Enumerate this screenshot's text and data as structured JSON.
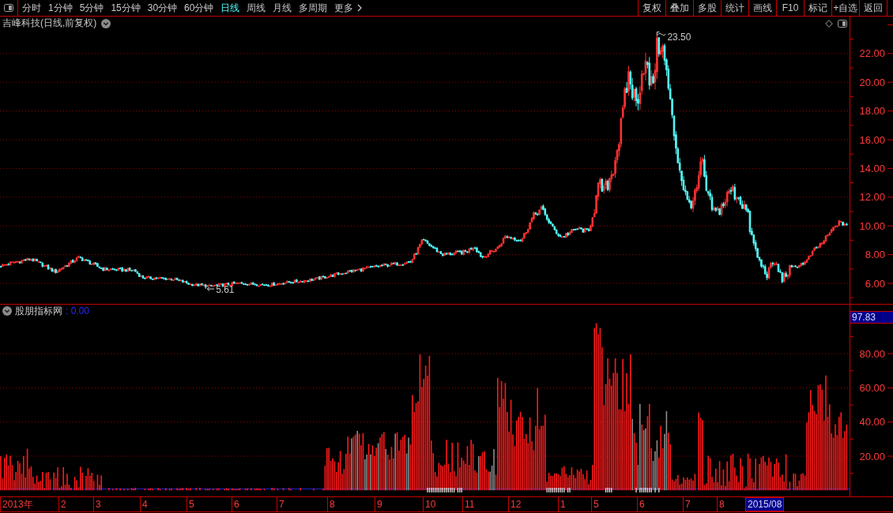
{
  "toolbar": {
    "tabs": [
      {
        "label": "分时",
        "kind": "period",
        "selected": false
      },
      {
        "label": "1分钟",
        "kind": "period",
        "selected": false
      },
      {
        "label": "5分钟",
        "kind": "period",
        "selected": false
      },
      {
        "label": "15分钟",
        "kind": "period",
        "selected": false
      },
      {
        "label": "30分钟",
        "kind": "period",
        "selected": false
      },
      {
        "label": "60分钟",
        "kind": "period",
        "selected": false
      },
      {
        "label": "日线",
        "kind": "period",
        "selected": true
      },
      {
        "label": "周线",
        "kind": "period",
        "selected": false
      },
      {
        "label": "月线",
        "kind": "period",
        "selected": false
      },
      {
        "label": "多周期",
        "kind": "period",
        "selected": false
      },
      {
        "label": "更多",
        "kind": "menu",
        "selected": false
      }
    ],
    "buttons": [
      "复权",
      "叠加",
      "多股",
      "统计",
      "画线",
      "F10",
      "标记",
      "+自选",
      "返回"
    ]
  },
  "price_panel": {
    "title": "吉峰科技(日线,前复权)",
    "high_label": "23.50",
    "low_label": "5.61",
    "axis_labels": [
      "22.00",
      "20.00",
      "18.00",
      "16.00",
      "14.00",
      "12.00",
      "10.00",
      "8.00",
      "6.00"
    ]
  },
  "indicator_panel": {
    "name": "股朋指标网",
    "reading": ": 0.00",
    "current_value": "97.83",
    "axis_labels": [
      "80.00",
      "60.00",
      "40.00",
      "20.00"
    ]
  },
  "date_axis": {
    "labels": [
      "2013年",
      "2",
      "3",
      "4",
      "5",
      "6",
      "7",
      "8",
      "9",
      "10",
      "11",
      "12",
      "1",
      "5",
      "6",
      "7",
      "8"
    ],
    "cursor_label": "2015/08"
  }
}
